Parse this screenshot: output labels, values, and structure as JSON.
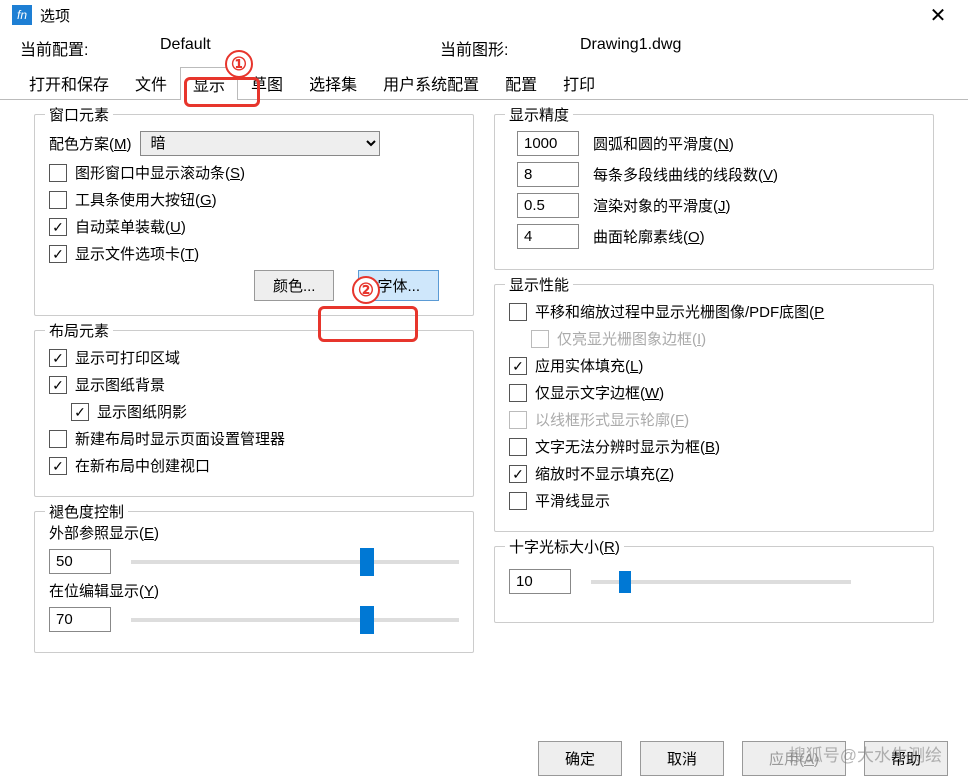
{
  "window": {
    "title": "选项"
  },
  "header": {
    "current_profile_label": "当前配置:",
    "current_profile_value": "Default",
    "current_drawing_label": "当前图形:",
    "current_drawing_value": "Drawing1.dwg"
  },
  "tabs": [
    "打开和保存",
    "文件",
    "显示",
    "草图",
    "选择集",
    "用户系统配置",
    "配置",
    "打印"
  ],
  "active_tab_index": 2,
  "annotations": {
    "circle1": "①",
    "circle2": "②"
  },
  "window_elements": {
    "title": "窗口元素",
    "color_scheme_label": "配色方案(",
    "color_scheme_key": "M",
    "color_scheme_value": "暗",
    "scrollbar_label": "图形窗口中显示滚动条(",
    "scrollbar_key": "S",
    "large_buttons_label": "工具条使用大按钮(",
    "large_buttons_key": "G",
    "auto_menu_label": "自动菜单装载(",
    "auto_menu_key": "U",
    "file_tabs_label": "显示文件选项卡(",
    "file_tabs_key": "T",
    "color_btn": "颜色...",
    "font_btn": "字体..."
  },
  "layout_elements": {
    "title": "布局元素",
    "print_area": "显示可打印区域",
    "paper_bg": "显示图纸背景",
    "paper_shadow": "显示图纸阴影",
    "page_setup_mgr": "新建布局时显示页面设置管理器",
    "create_viewport": "在新布局中创建视口"
  },
  "fade_control": {
    "title": "褪色度控制",
    "xref_label": "外部参照显示(",
    "xref_key": "E",
    "xref_value": "50",
    "xref_pct": 72,
    "inplace_label": "在位编辑显示(",
    "inplace_key": "Y",
    "inplace_value": "70",
    "inplace_pct": 72
  },
  "precision": {
    "title": "显示精度",
    "arc_value": "1000",
    "arc_label": "圆弧和圆的平滑度(",
    "arc_key": "N",
    "polyline_value": "8",
    "polyline_label": "每条多段线曲线的线段数(",
    "polyline_key": "V",
    "render_value": "0.5",
    "render_label": "渲染对象的平滑度(",
    "render_key": "J",
    "surface_value": "4",
    "surface_label": "曲面轮廓素线(",
    "surface_key": "O"
  },
  "performance": {
    "title": "显示性能",
    "pan_zoom_label": "平移和缩放过程中显示光栅图像/PDF底图(",
    "pan_zoom_key": "P",
    "highlight_frame_label": "仅亮显光栅图象边框(",
    "highlight_frame_key": "I",
    "solid_fill_label": "应用实体填充(",
    "solid_fill_key": "L",
    "text_frame_label": "仅显示文字边框(",
    "text_frame_key": "W",
    "wireframe_label": "以线框形式显示轮廓(",
    "wireframe_key": "F",
    "text_boxes_label": "文字无法分辨时显示为框(",
    "text_boxes_key": "B",
    "no_fill_zoom_label": "缩放时不显示填充(",
    "no_fill_zoom_key": "Z",
    "smooth_lines_label": "平滑线显示"
  },
  "crosshair": {
    "title": "十字光标大小(",
    "key": "R",
    "value": "10",
    "pct": 13
  },
  "buttons": {
    "ok": "确定",
    "cancel": "取消",
    "apply_prefix": "应用(",
    "apply_key": "A",
    "help": "帮助"
  },
  "watermark": "搜狐号@大水牛测绘"
}
